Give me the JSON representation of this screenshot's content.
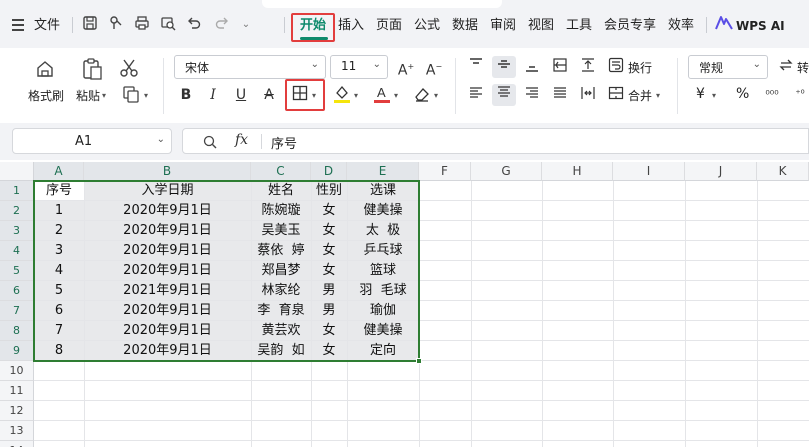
{
  "menu": {
    "file": "文件",
    "tabs": [
      "开始",
      "插入",
      "页面",
      "公式",
      "数据",
      "审阅",
      "视图",
      "工具",
      "会员专享",
      "效率"
    ],
    "wps_ai": "WPS AI"
  },
  "ribbon": {
    "format_painter": "格式刷",
    "paste": "粘贴",
    "font_name": "宋体",
    "font_size": "11",
    "wrap_text": "换行",
    "merge": "合并",
    "number_format": "常规",
    "convert_truncated": "转",
    "percent": "%",
    "currency": "¥"
  },
  "formula_bar": {
    "name_box": "A1",
    "fx": "fx",
    "content": "序号"
  },
  "colors": {
    "accent": "#0e8a6c",
    "selection_border": "#2e7d32",
    "highlight_box": "#e23d3d",
    "font_color": "#e23d3d",
    "fill_color": "#f5e50c"
  },
  "sheet": {
    "columns": [
      "A",
      "B",
      "C",
      "D",
      "E",
      "F",
      "G",
      "H",
      "I",
      "J",
      "K"
    ],
    "rows": [
      "1",
      "2",
      "3",
      "4",
      "5",
      "6",
      "7",
      "8",
      "9",
      "10",
      "11",
      "12",
      "13",
      "14"
    ],
    "data": [
      [
        "序号",
        "入学日期",
        "姓名",
        "性别",
        "选课"
      ],
      [
        "1",
        "2020年9月1日",
        "陈婉璇",
        "女",
        "健美操"
      ],
      [
        "2",
        "2020年9月1日",
        "吴美玉",
        "女",
        "太  极"
      ],
      [
        "3",
        "2020年9月1日",
        "蔡依  婷",
        "女",
        "乒乓球"
      ],
      [
        "4",
        "2020年9月1日",
        "郑昌梦",
        "女",
        "篮球"
      ],
      [
        "5",
        "2021年9月1日",
        "林家纶",
        "男",
        "羽  毛球"
      ],
      [
        "6",
        "2020年9月1日",
        "李  育泉",
        "男",
        "瑜伽"
      ],
      [
        "7",
        "2020年9月1日",
        "黄芸欢",
        "女",
        "健美操"
      ],
      [
        "8",
        "2020年9月1日",
        "吴韵  如",
        "女",
        "定向"
      ]
    ]
  }
}
